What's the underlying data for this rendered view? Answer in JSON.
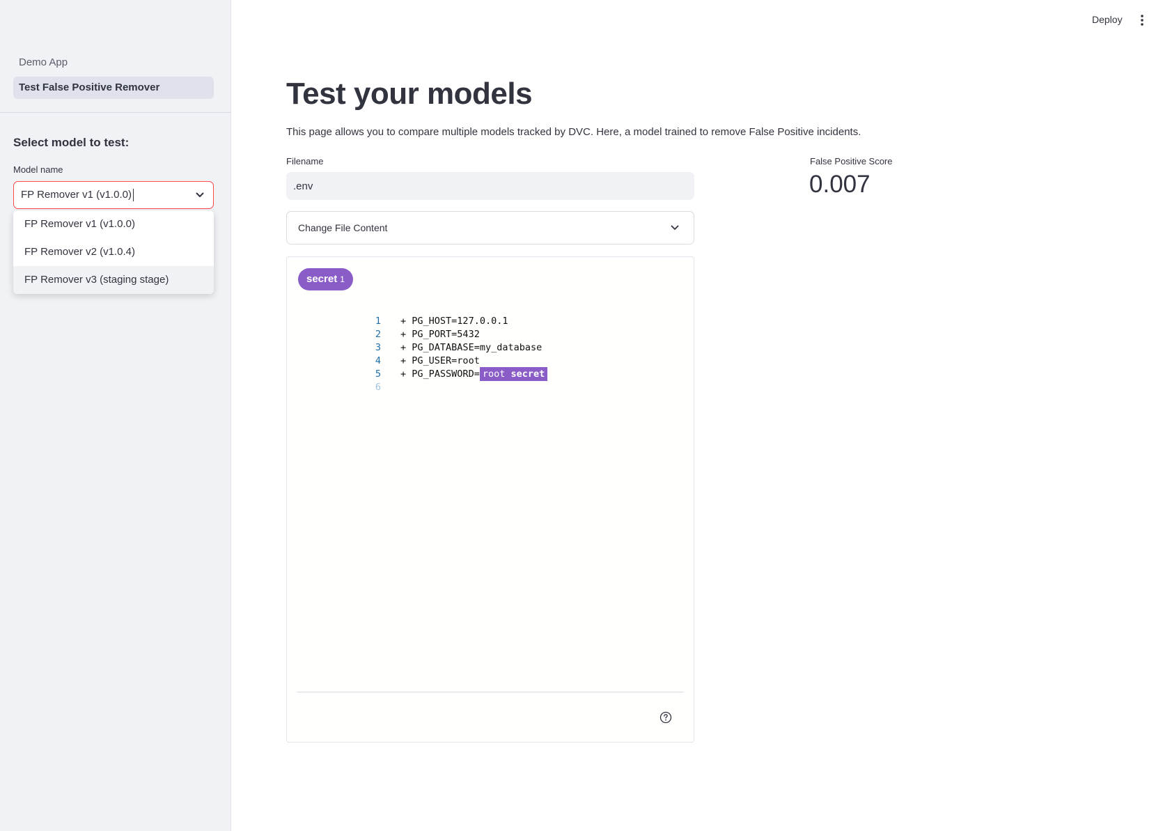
{
  "sidebar": {
    "nav": [
      {
        "label": "Demo App",
        "active": false
      },
      {
        "label": "Test False Positive Remover",
        "active": true
      }
    ],
    "heading": "Select model to test:",
    "model_select": {
      "label": "Model name",
      "value": "FP Remover v1 (v1.0.0)",
      "options": [
        "FP Remover v1 (v1.0.0)",
        "FP Remover v2 (v1.0.4)",
        "FP Remover v3 (staging stage)"
      ]
    }
  },
  "header": {
    "deploy_label": "Deploy"
  },
  "main": {
    "title": "Test your models",
    "description": "This page allows you to compare multiple models tracked by DVC. Here, a model trained to remove False Positive incidents.",
    "filename": {
      "label": "Filename",
      "value": ".env"
    },
    "expander_label": "Change File Content",
    "code_view": {
      "badge_label": "secret",
      "badge_count": "1",
      "lines": [
        {
          "num": "1",
          "text": "+ PG_HOST=127.0.0.1"
        },
        {
          "num": "2",
          "text": "+ PG_PORT=5432"
        },
        {
          "num": "3",
          "text": "+ PG_DATABASE=my_database"
        },
        {
          "num": "4",
          "text": "+ PG_USER=root"
        },
        {
          "num": "5",
          "text": "+ PG_PASSWORD=",
          "highlight_value": "root",
          "highlight_tag": "secret"
        },
        {
          "num": "6",
          "text": ""
        }
      ]
    },
    "metric": {
      "label": "False Positive Score",
      "value": "0.007"
    }
  },
  "colors": {
    "accent_red": "#ff4b4b",
    "secret_purple": "#8a5cc8",
    "sidebar_bg": "#f0f2f6"
  }
}
